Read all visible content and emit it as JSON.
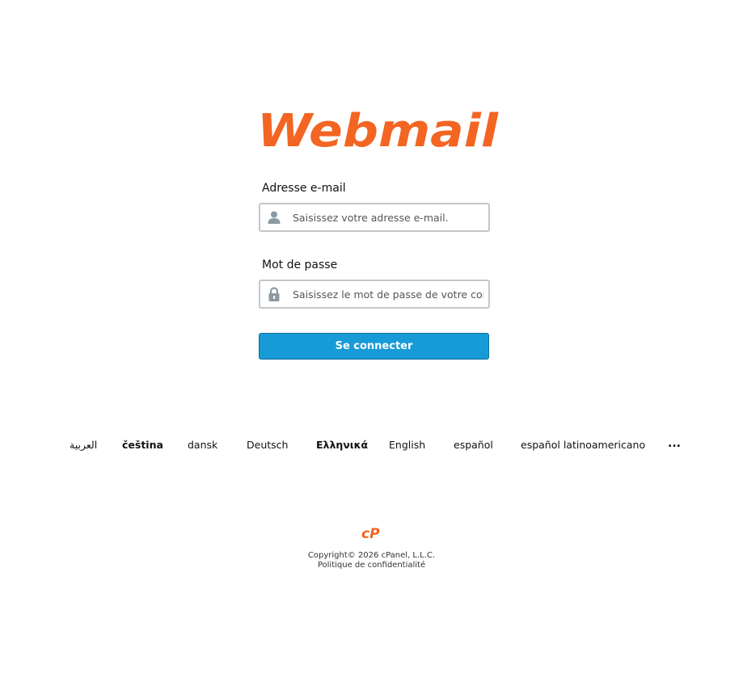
{
  "logo": {
    "text": "Webmail",
    "color": "#f26522"
  },
  "form": {
    "email_label": "Adresse e-mail",
    "email_placeholder": "Saisissez votre adresse e-mail.",
    "password_label": "Mot de passe",
    "password_placeholder": "Saisissez le mot de passe de votre compte.",
    "submit_label": "Se connecter",
    "email_icon": "user-icon",
    "password_icon": "lock-icon",
    "button_color": "#179bd7"
  },
  "languages": {
    "items": [
      "العربية",
      "čeština",
      "dansk",
      "Deutsch",
      "Ελληνικά",
      "English",
      "español",
      "español latinoamericano"
    ],
    "more_label": "..."
  },
  "footer": {
    "brand": "cP",
    "copyright": "Copyright© 2026 cPanel, L.L.C.",
    "privacy": "Politique de confidentialité",
    "brand_color": "#f26522"
  }
}
